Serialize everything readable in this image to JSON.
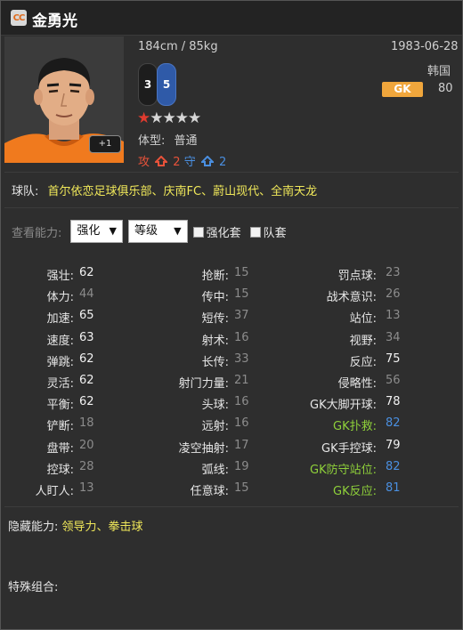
{
  "header": {
    "logo_text": "CC",
    "player_name": "金勇光"
  },
  "profile": {
    "height_weight": "184cm / 85kg",
    "birthdate": "1983-06-28",
    "nationality": "韩国",
    "position": "GK",
    "rating": "80",
    "left_foot": "3",
    "right_foot": "5",
    "stars_filled": 1,
    "stars_total": 5,
    "plus_badge": "+1",
    "body_type_label": "体型:",
    "body_type": "普通",
    "attack_label": "攻",
    "attack_value": "2",
    "defend_label": "守",
    "defend_value": "2"
  },
  "teams": {
    "label": "球队:",
    "value": "首尔依恋足球俱乐部、庆南FC、蔚山现代、全南天龙"
  },
  "view_controls": {
    "label": "查看能力:",
    "select1": "强化",
    "select2": "等级",
    "checkbox1": "强化套",
    "checkbox2": "队套"
  },
  "stats": {
    "col1": [
      {
        "label": "强壮:",
        "value": "62",
        "style": "white"
      },
      {
        "label": "体力:",
        "value": "44",
        "style": "grey"
      },
      {
        "label": "加速:",
        "value": "65",
        "style": "white"
      },
      {
        "label": "速度:",
        "value": "63",
        "style": "white"
      },
      {
        "label": "弹跳:",
        "value": "62",
        "style": "white"
      },
      {
        "label": "灵活:",
        "value": "62",
        "style": "white"
      },
      {
        "label": "平衡:",
        "value": "62",
        "style": "white"
      },
      {
        "label": "铲断:",
        "value": "18",
        "style": "grey"
      },
      {
        "label": "盘带:",
        "value": "20",
        "style": "grey"
      },
      {
        "label": "控球:",
        "value": "28",
        "style": "grey"
      },
      {
        "label": "人盯人:",
        "value": "13",
        "style": "grey"
      }
    ],
    "col2": [
      {
        "label": "抢断:",
        "value": "15",
        "style": "grey"
      },
      {
        "label": "传中:",
        "value": "15",
        "style": "grey"
      },
      {
        "label": "短传:",
        "value": "37",
        "style": "grey"
      },
      {
        "label": "射术:",
        "value": "16",
        "style": "grey"
      },
      {
        "label": "长传:",
        "value": "33",
        "style": "grey"
      },
      {
        "label": "射门力量:",
        "value": "21",
        "style": "grey"
      },
      {
        "label": "头球:",
        "value": "16",
        "style": "grey"
      },
      {
        "label": "远射:",
        "value": "16",
        "style": "grey"
      },
      {
        "label": "凌空抽射:",
        "value": "17",
        "style": "grey"
      },
      {
        "label": "弧线:",
        "value": "19",
        "style": "grey"
      },
      {
        "label": "任意球:",
        "value": "15",
        "style": "grey"
      }
    ],
    "col3": [
      {
        "label": "罚点球:",
        "value": "23",
        "style": "grey"
      },
      {
        "label": "战术意识:",
        "value": "26",
        "style": "grey"
      },
      {
        "label": "站位:",
        "value": "13",
        "style": "grey"
      },
      {
        "label": "视野:",
        "value": "34",
        "style": "grey"
      },
      {
        "label": "反应:",
        "value": "75",
        "style": "white"
      },
      {
        "label": "侵略性:",
        "value": "56",
        "style": "grey"
      },
      {
        "label": "GK大脚开球:",
        "value": "78",
        "style": "white"
      },
      {
        "label": "GK扑救:",
        "value": "82",
        "style": "blue",
        "green": true
      },
      {
        "label": "GK手控球:",
        "value": "79",
        "style": "white"
      },
      {
        "label": "GK防守站位:",
        "value": "82",
        "style": "blue",
        "green": true
      },
      {
        "label": "GK反应:",
        "value": "81",
        "style": "blue",
        "green": true
      }
    ]
  },
  "hidden_abilities": {
    "label": "隐藏能力:",
    "value": "领导力、拳击球"
  },
  "special_combo": {
    "label": "特殊组合:",
    "value": ""
  },
  "colors": {
    "accent_yellow": "#f0e85a",
    "gk_badge": "#f0a63c",
    "attack_red": "#e8523a",
    "defend_blue": "#4a8fe0",
    "highlight_green": "#8fd13a"
  }
}
